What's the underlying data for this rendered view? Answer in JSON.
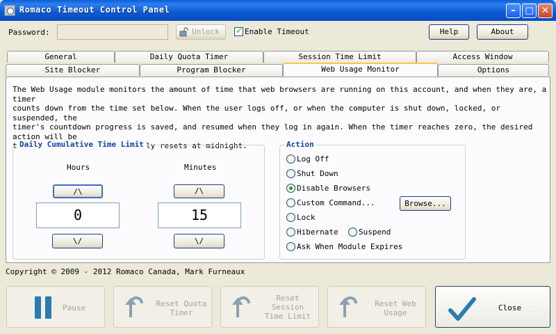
{
  "window": {
    "title": "Romaco Timeout Control Panel"
  },
  "top": {
    "password_label": "Password:",
    "password_value": "",
    "unlock_label": "Unlock",
    "enable_timeout_label": "Enable Timeout",
    "enable_timeout_checked": true,
    "help_label": "Help",
    "about_label": "About"
  },
  "tabs_row1": [
    "General",
    "Daily Quota Timer",
    "Session Time Limit",
    "Access Window"
  ],
  "tabs_row2": [
    "Site Blocker",
    "Program Blocker",
    "Web Usage Monitor",
    "Options"
  ],
  "active_tab": "Web Usage Monitor",
  "description": "The Web Usage module monitors the amount of time that web browsers are running on this account, and when they are, a timer\ncounts down from the time set below. When the user logs off, or when the computer is shut down, locked, or suspended, the\ntimer's countdown progress is saved, and resumed when they log in again. When the timer reaches zero, the desired action will be\ntaken. This timer automatically resets at midnight.",
  "daily_limit": {
    "title": "Daily Cumulative Time Limit",
    "hours_label": "Hours",
    "minutes_label": "Minutes",
    "hours": "0",
    "minutes": "15",
    "up_label": "/\\",
    "down_label": "\\/"
  },
  "action": {
    "title": "Action",
    "options": [
      "Log Off",
      "Shut Down",
      "Disable Browsers",
      "Custom Command...",
      "Lock",
      "Hibernate",
      "Suspend",
      "Ask When Module Expires"
    ],
    "selected": "Disable Browsers",
    "browse_label": "Browse..."
  },
  "copyright": "Copyright © 2009 - 2012 Romaco Canada, Mark Furneaux",
  "bottom_buttons": {
    "pause": "Pause",
    "reset_quota": "Reset Quota\nTimer",
    "reset_session": "Reset\nSession\nTime Limit",
    "reset_web": "Reset Web\nUsage",
    "close": "Close"
  },
  "colors": {
    "accent_blue": "#1540a6",
    "checked_green": "#21a121",
    "pause_icon": "#2a7bb0"
  }
}
